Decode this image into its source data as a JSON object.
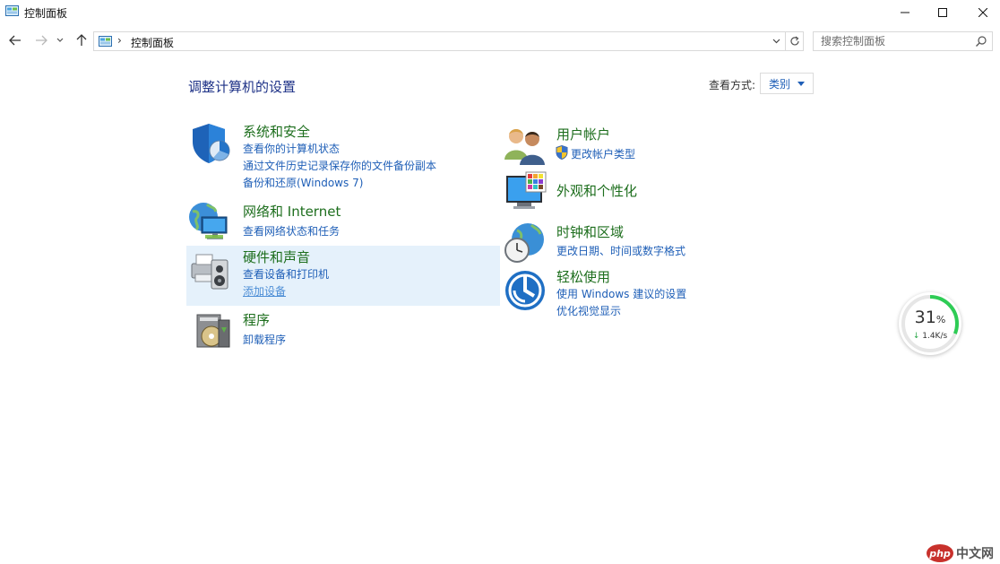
{
  "window": {
    "title": "控制面板"
  },
  "address": {
    "crumb": "控制面板",
    "separator": "›"
  },
  "search": {
    "placeholder": "搜索控制面板"
  },
  "heading": "调整计算机的设置",
  "view_by": {
    "label": "查看方式:",
    "value": "类别"
  },
  "left_categories": [
    {
      "title": "系统和安全",
      "icon": "shield-icon",
      "links": [
        "查看你的计算机状态",
        "通过文件历史记录保存你的文件备份副本",
        "备份和还原(Windows 7)"
      ]
    },
    {
      "title": "网络和 Internet",
      "icon": "network-icon",
      "links": [
        "查看网络状态和任务"
      ]
    },
    {
      "title": "硬件和声音",
      "icon": "printer-icon",
      "links": [
        "查看设备和打印机",
        "添加设备"
      ]
    },
    {
      "title": "程序",
      "icon": "programs-icon",
      "links": [
        "卸载程序"
      ]
    }
  ],
  "right_categories": [
    {
      "title": "用户帐户",
      "icon": "users-icon",
      "links": [
        "更改帐户类型"
      ]
    },
    {
      "title": "外观和个性化",
      "icon": "display-icon",
      "links": []
    },
    {
      "title": "时钟和区域",
      "icon": "clock-globe-icon",
      "links": [
        "更改日期、时间或数字格式"
      ]
    },
    {
      "title": "轻松使用",
      "icon": "ease-of-access-icon",
      "links": [
        "使用 Windows 建议的设置",
        "优化视觉显示"
      ]
    }
  ],
  "speed_widget": {
    "percent": "31",
    "unit": "%",
    "arrow": "↓",
    "rate": "1.4K/s",
    "fraction": 0.31
  },
  "watermark": {
    "badge": "php",
    "text": "中文网"
  },
  "colors": {
    "title_green": "#1d6e1d",
    "link_blue": "#1f5fb7",
    "heading_blue": "#1e3287",
    "highlight": "#e5f1fb",
    "progress_green": "#2ecc55"
  }
}
